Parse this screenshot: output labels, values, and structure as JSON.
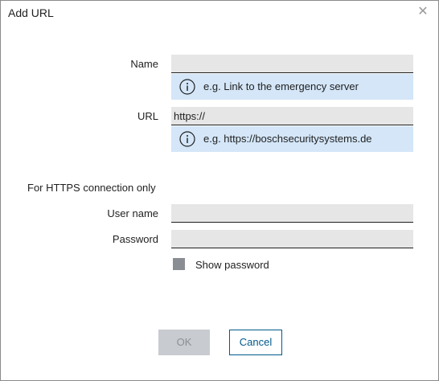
{
  "window": {
    "title": "Add URL",
    "close_icon": "close-icon"
  },
  "form": {
    "name": {
      "label": "Name",
      "value": "",
      "hint": "e.g. Link to the emergency server",
      "hint_icon": "info-icon"
    },
    "url": {
      "label": "URL",
      "value": "https://",
      "hint": "e.g. https://boschsecuritysystems.de",
      "hint_icon": "info-icon"
    },
    "https_section": {
      "label": "For HTTPS connection only"
    },
    "username": {
      "label": "User name",
      "value": ""
    },
    "password": {
      "label": "Password",
      "value": ""
    },
    "show_password": {
      "label": "Show password",
      "checked": false
    }
  },
  "buttons": {
    "ok": "OK",
    "ok_enabled": false,
    "cancel": "Cancel"
  },
  "colors": {
    "hint_background": "#d4e6f8",
    "field_background": "#e6e6e6",
    "accent": "#005a8c",
    "disabled_button": "#c8cbd0",
    "checkbox": "#8a8d93"
  }
}
